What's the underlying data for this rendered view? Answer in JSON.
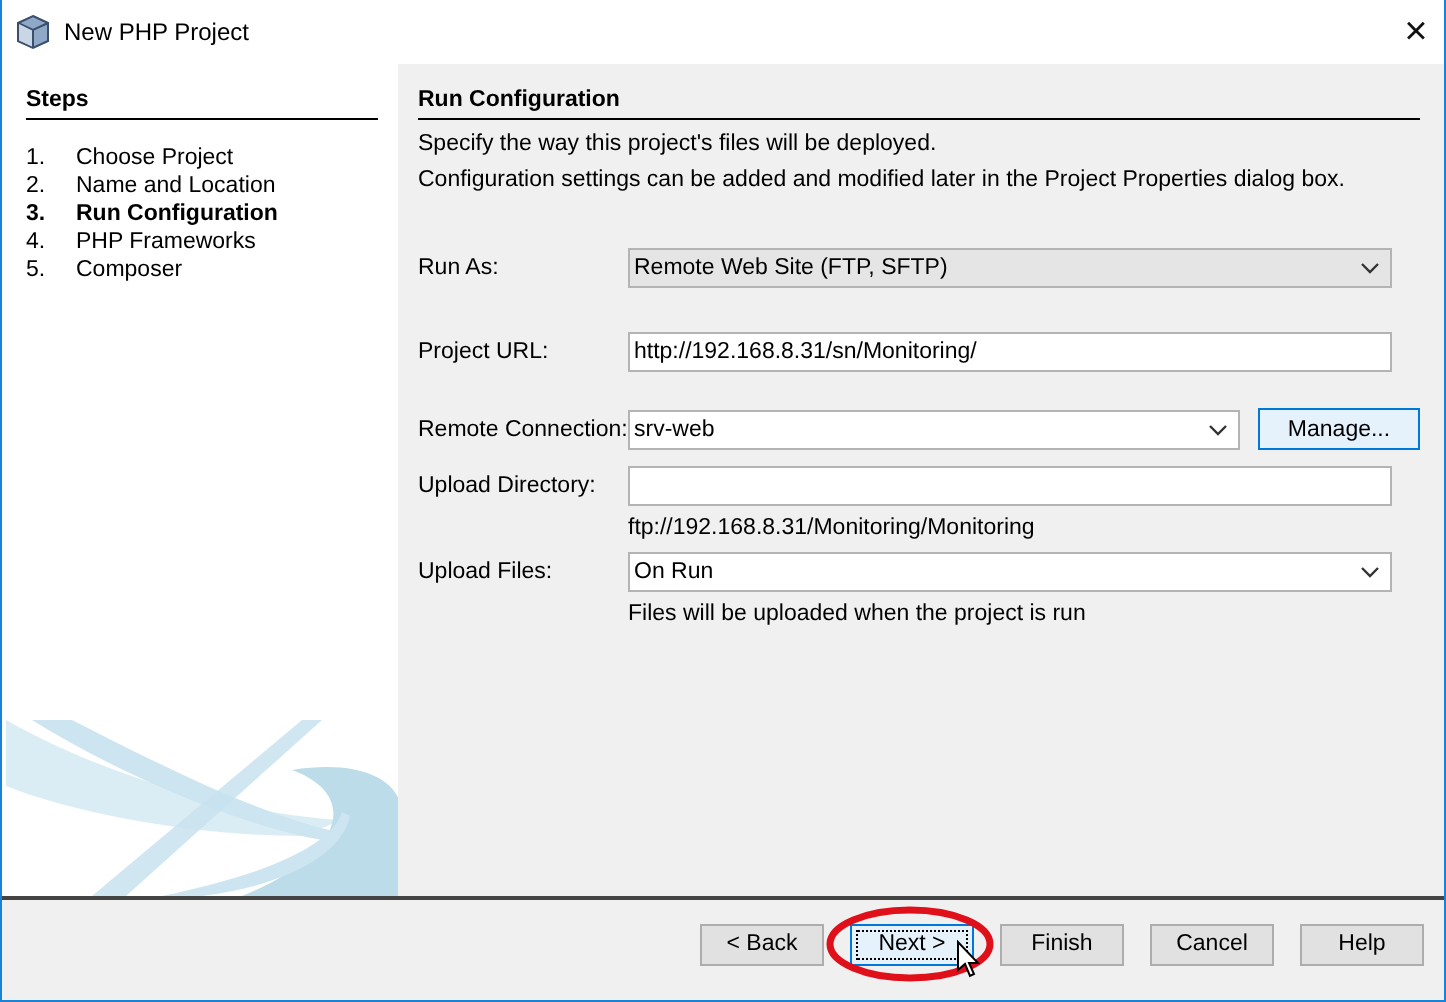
{
  "window": {
    "title": "New PHP Project",
    "close": "×"
  },
  "steps": {
    "title": "Steps",
    "items": [
      {
        "number": "1.",
        "label": "Choose Project",
        "selected": false
      },
      {
        "number": "2.",
        "label": "Name and Location",
        "selected": false
      },
      {
        "number": "3.",
        "label": "Run Configuration",
        "selected": true
      },
      {
        "number": "4.",
        "label": "PHP Frameworks",
        "selected": false
      },
      {
        "number": "5.",
        "label": "Composer",
        "selected": false
      }
    ]
  },
  "panel": {
    "title": "Run Configuration",
    "description": [
      "Specify the way this project's files will be deployed.",
      "Configuration settings can be added and modified later in the Project Properties dialog box."
    ]
  },
  "fields": [
    {
      "kind": "select",
      "label": "Run As:",
      "value": "Remote Web Site (FTP, SFTP)",
      "editable": false
    },
    {
      "kind": "text",
      "label": "Project URL:",
      "value": "http://192.168.8.31/sn/Monitoring/"
    },
    {
      "kind": "combo",
      "label": "Remote Connection:",
      "value": "srv-web",
      "editable": true,
      "button": {
        "label": "Manage...",
        "focused": true
      }
    },
    {
      "kind": "text",
      "label": "Upload Directory:",
      "hint": "ftp://192.168.8.31/Monitoring/Monitoring"
    },
    {
      "kind": "combo",
      "label": "Upload Files:",
      "value": "On Run",
      "editable": true,
      "hint": "Files will be uploaded when the project is run"
    }
  ],
  "buttons": [
    {
      "label": "< Back",
      "focused": false
    },
    {
      "label": "Next >",
      "focused": true,
      "circled": true,
      "pointer": true
    },
    {
      "label": "Finish",
      "focused": false
    },
    {
      "label": "Cancel",
      "focused": false
    },
    {
      "label": "Help",
      "focused": false
    }
  ]
}
